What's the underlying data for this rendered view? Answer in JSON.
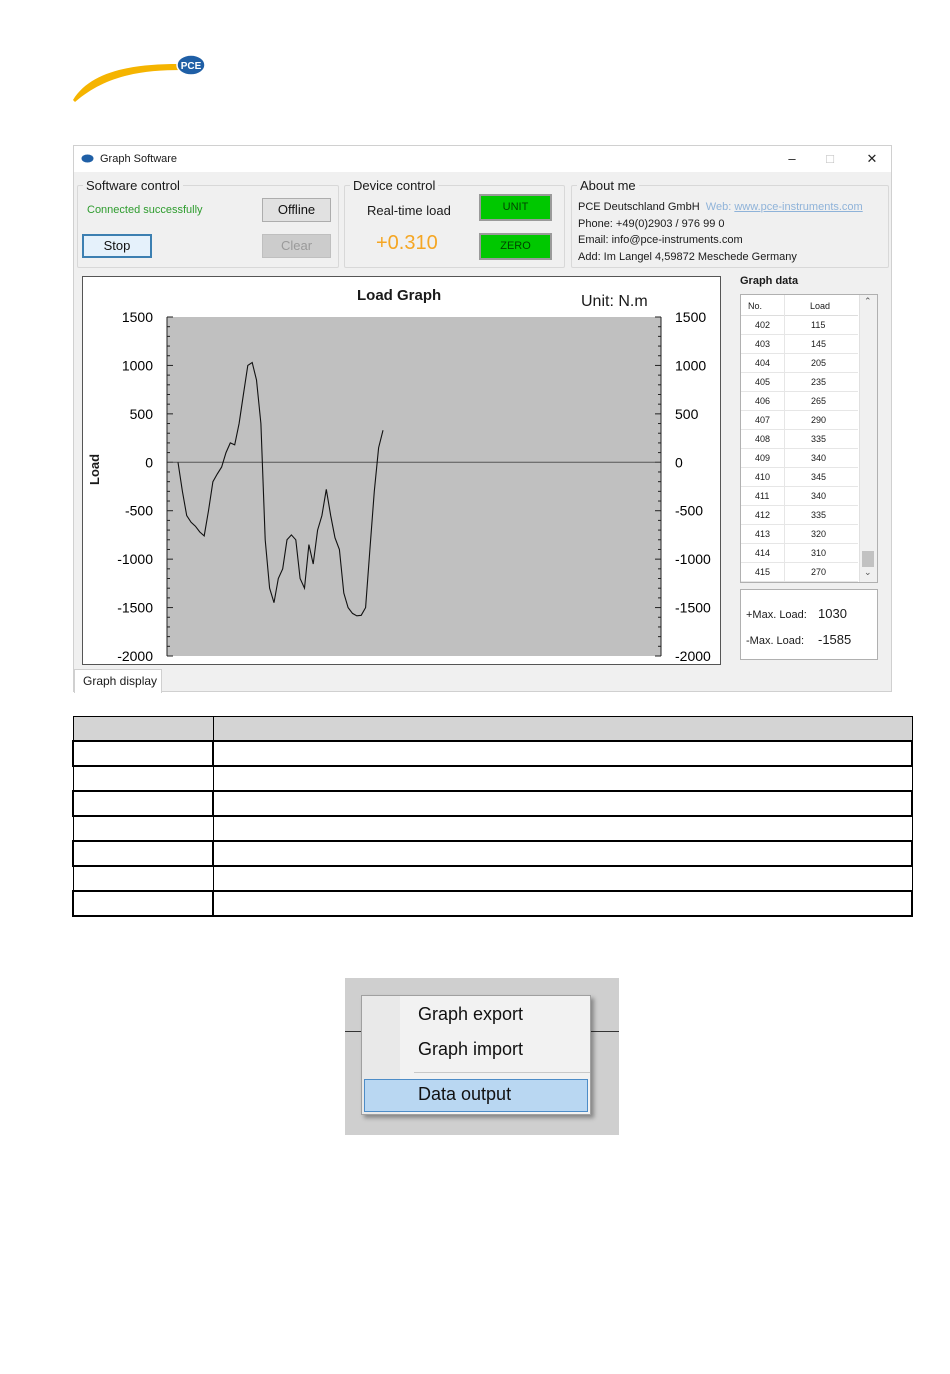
{
  "logo": {
    "text": "PCE",
    "icon": "pce-logo-icon",
    "colors": {
      "swoosh": "#f5b400",
      "badge": "#1f5fa6"
    }
  },
  "window": {
    "title": "Graph Software",
    "controls": {
      "minimize": "–",
      "maximize": "□",
      "close": "✕"
    }
  },
  "software_control": {
    "legend": "Software control",
    "status": "Connected successfully",
    "offline_label": "Offline",
    "stop_label": "Stop",
    "clear_label": "Clear"
  },
  "device_control": {
    "legend": "Device control",
    "realtime_label": "Real-time load",
    "realtime_value": "+0.310",
    "unit_label": "UNIT",
    "zero_label": "ZERO"
  },
  "about": {
    "legend": "About me",
    "company": "PCE Deutschland GmbH",
    "web_label": "Web:",
    "web_link": "www.pce-instruments.com",
    "phone": "Phone: +49(0)2903 / 976 99 0",
    "email": "Email: info@pce-instruments.com",
    "address": "Add: Im Langel 4,59872 Meschede Germany"
  },
  "graph_data_label": "Graph data",
  "table": {
    "headers": [
      "No.",
      "Load"
    ],
    "rows": [
      [
        "402",
        "115"
      ],
      [
        "403",
        "145"
      ],
      [
        "404",
        "205"
      ],
      [
        "405",
        "235"
      ],
      [
        "406",
        "265"
      ],
      [
        "407",
        "290"
      ],
      [
        "408",
        "335"
      ],
      [
        "409",
        "340"
      ],
      [
        "410",
        "345"
      ],
      [
        "411",
        "340"
      ],
      [
        "412",
        "335"
      ],
      [
        "413",
        "320"
      ],
      [
        "414",
        "310"
      ],
      [
        "415",
        "270"
      ]
    ]
  },
  "max": {
    "pos_label": "+Max. Load:",
    "pos_value": "1030",
    "neg_label": "-Max. Load:",
    "neg_value": "-1585"
  },
  "tab_label": "Graph display",
  "chart_data": {
    "type": "line",
    "title": "Load Graph",
    "unit_label": "Unit:  N.m",
    "ylabel": "Load",
    "ylim": [
      -2000,
      1500
    ],
    "yticks": [
      "1500",
      "1000",
      "500",
      "0",
      "-500",
      "-1000",
      "-1500",
      "-2000"
    ],
    "grid": false,
    "plot_background": "#c0c0c0",
    "series": [
      {
        "values": [
          0,
          -300,
          -550,
          -620,
          -660,
          -720,
          -760,
          -500,
          -200,
          -120,
          -50,
          100,
          200,
          180,
          400,
          700,
          1000,
          1030,
          850,
          400,
          -800,
          -1300,
          -1450,
          -1200,
          -1100,
          -800,
          -750,
          -800,
          -1200,
          -1300,
          -850,
          -1050,
          -700,
          -550,
          -280,
          -550,
          -780,
          -900,
          -1350,
          -1500,
          -1560,
          -1585,
          -1580,
          -1500,
          -900,
          -300,
          150,
          330
        ]
      }
    ]
  },
  "menu": {
    "items": [
      "Graph export",
      "Graph import",
      "Data output"
    ],
    "selected": "Data output"
  }
}
